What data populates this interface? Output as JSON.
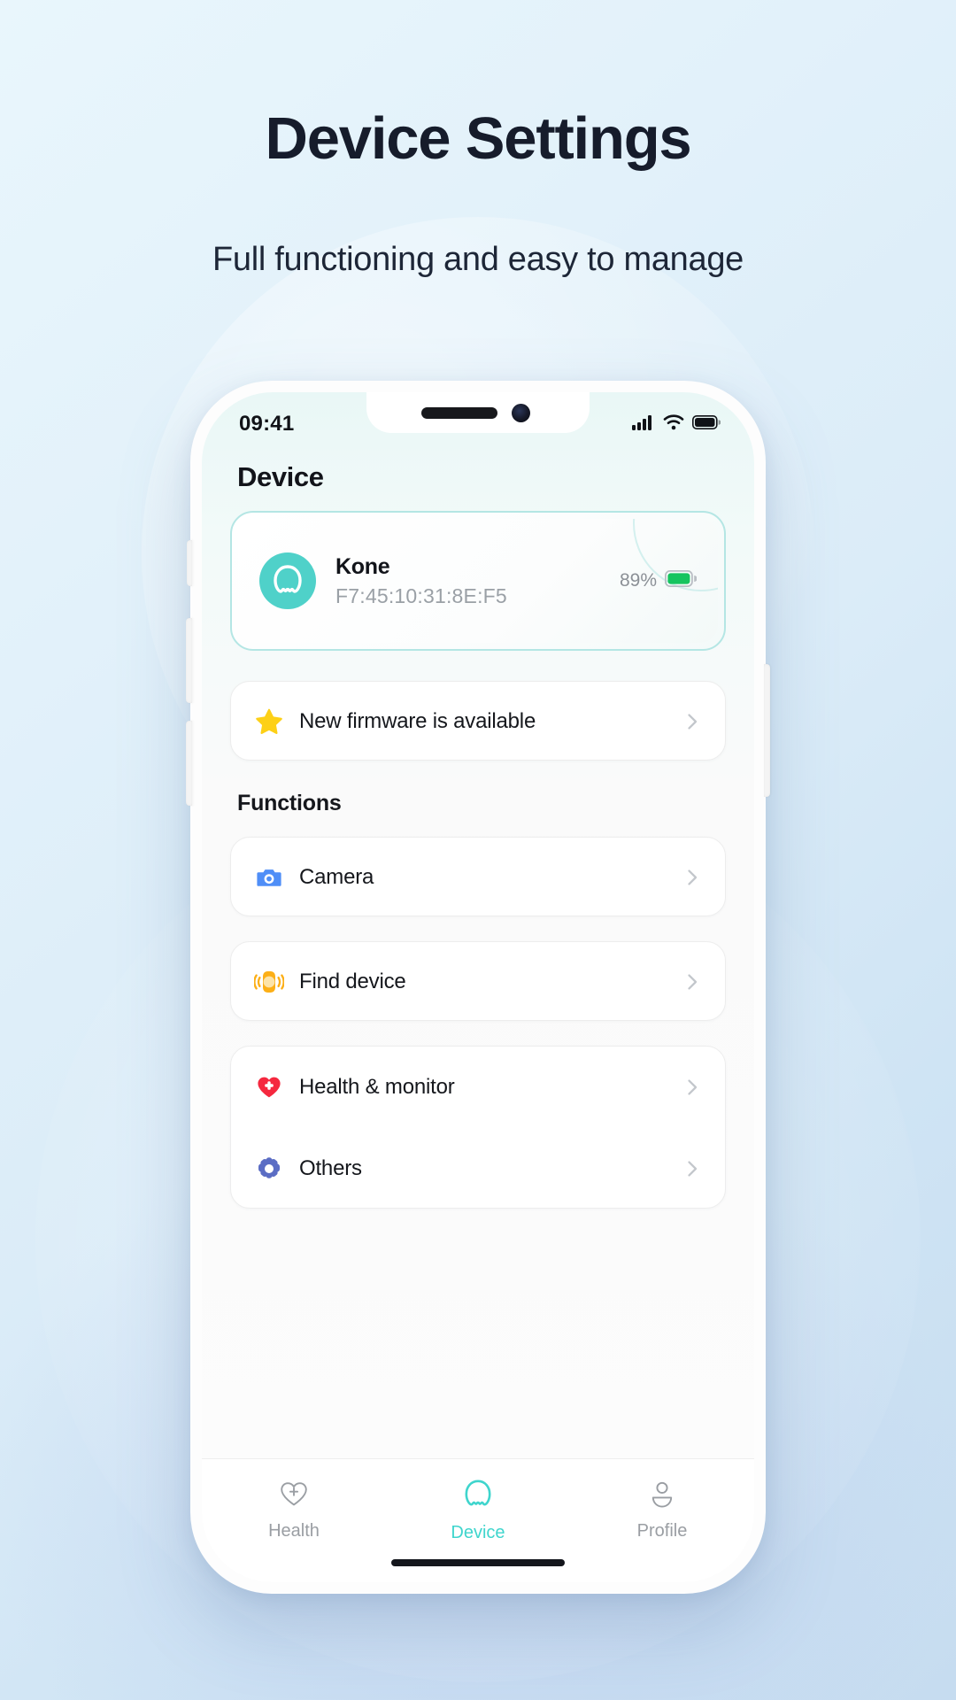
{
  "promo": {
    "title": "Device Settings",
    "subtitle": "Full functioning and easy to manage"
  },
  "colors": {
    "accent_teal": "#3fd5cd",
    "device_icon_bg": "#4fd1c9",
    "battery_green": "#16c45f",
    "star_yellow": "#fdd017",
    "camera_blue": "#4f8ef7",
    "watch_amber": "#fcaf17",
    "heart_red": "#f5283f",
    "gear_indigo": "#5b6dc4",
    "muted_text": "#9aa0a6"
  },
  "phone": {
    "status_bar": {
      "time": "09:41",
      "signal_icon": "cellular-signal-icon",
      "wifi_icon": "wifi-icon",
      "battery_icon": "battery-icon"
    },
    "page_title": "Device",
    "device_card": {
      "icon": "earbud-device-icon",
      "name": "Kone",
      "mac_address": "F7:45:10:31:8E:F5",
      "battery_percent": "89%",
      "battery_icon": "battery-full-icon"
    },
    "firmware_row": {
      "icon": "star-icon",
      "label": "New firmware is available",
      "chevron": "chevron-right-icon"
    },
    "functions_section_title": "Functions",
    "function_rows": [
      {
        "icon": "camera-icon",
        "label": "Camera",
        "chevron": "chevron-right-icon"
      },
      {
        "icon": "find-device-watch-icon",
        "label": "Find device",
        "chevron": "chevron-right-icon"
      },
      {
        "icon": "heart-plus-icon",
        "label": "Health & monitor",
        "chevron": "chevron-right-icon"
      },
      {
        "icon": "gear-icon",
        "label": "Others",
        "chevron": "chevron-right-icon"
      }
    ],
    "tabs": [
      {
        "icon": "heart-plus-outline-icon",
        "label": "Health",
        "active": false
      },
      {
        "icon": "device-ring-icon",
        "label": "Device",
        "active": true
      },
      {
        "icon": "person-icon",
        "label": "Profile",
        "active": false
      }
    ]
  }
}
